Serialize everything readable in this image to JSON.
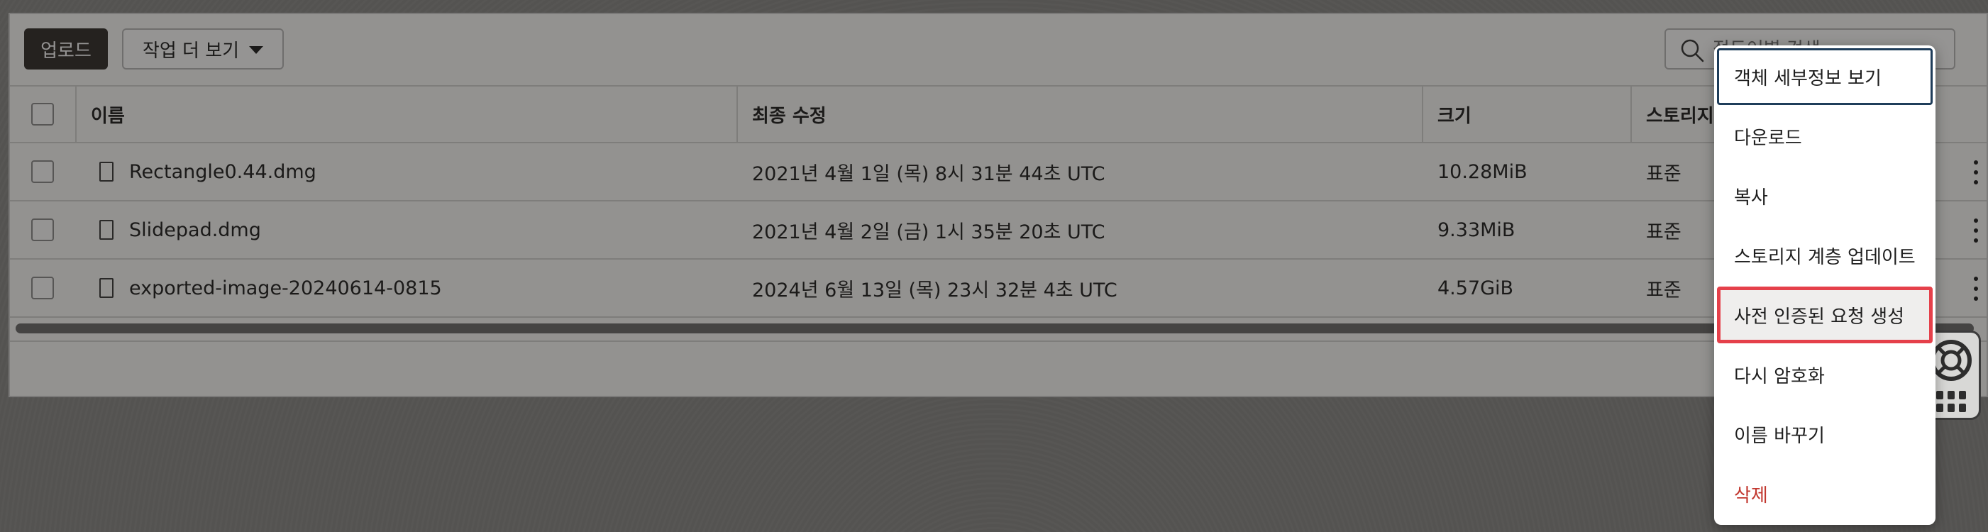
{
  "toolbar": {
    "upload_label": "업로드",
    "more_actions_label": "작업 더 보기",
    "search": {
      "placeholder": "접두어별 검색"
    }
  },
  "table": {
    "columns": [
      "이름",
      "최종 수정",
      "크기",
      "스토리지 계층"
    ],
    "rows": [
      {
        "name": "Rectangle0.44.dmg",
        "modified": "2021년 4월 1일 (목) 8시 31분 44초 UTC",
        "size": "10.28MiB",
        "tier": "표준"
      },
      {
        "name": "Slidepad.dmg",
        "modified": "2021년 4월 2일 (금) 1시 35분 20초 UTC",
        "size": "9.33MiB",
        "tier": "표준"
      },
      {
        "name": "exported-image-20240614-0815",
        "modified": "2024년 6월 13일 (목) 23시 32분 4초 UTC",
        "size": "4.57GiB",
        "tier": "표준"
      }
    ]
  },
  "context_menu": {
    "items": [
      {
        "label": "객체 세부정보 보기",
        "state": "focused"
      },
      {
        "label": "다운로드",
        "state": "normal"
      },
      {
        "label": "복사",
        "state": "normal"
      },
      {
        "label": "스토리지 계층 업데이트",
        "state": "normal"
      },
      {
        "label": "사전 인증된 요청 생성",
        "state": "highlighted"
      },
      {
        "label": "다시 암호화",
        "state": "normal"
      },
      {
        "label": "이름 바꾸기",
        "state": "normal"
      },
      {
        "label": "삭제",
        "state": "danger"
      }
    ]
  },
  "colors": {
    "primary_button": "#312d2a",
    "focus_ring": "#1f3d5a",
    "highlight_border": "#e5404a",
    "danger_text": "#c2382f"
  },
  "icons": [
    "search-icon",
    "chevron-down-icon",
    "file-icon",
    "kebab-icon",
    "lifebuoy-icon",
    "grid-icon"
  ]
}
